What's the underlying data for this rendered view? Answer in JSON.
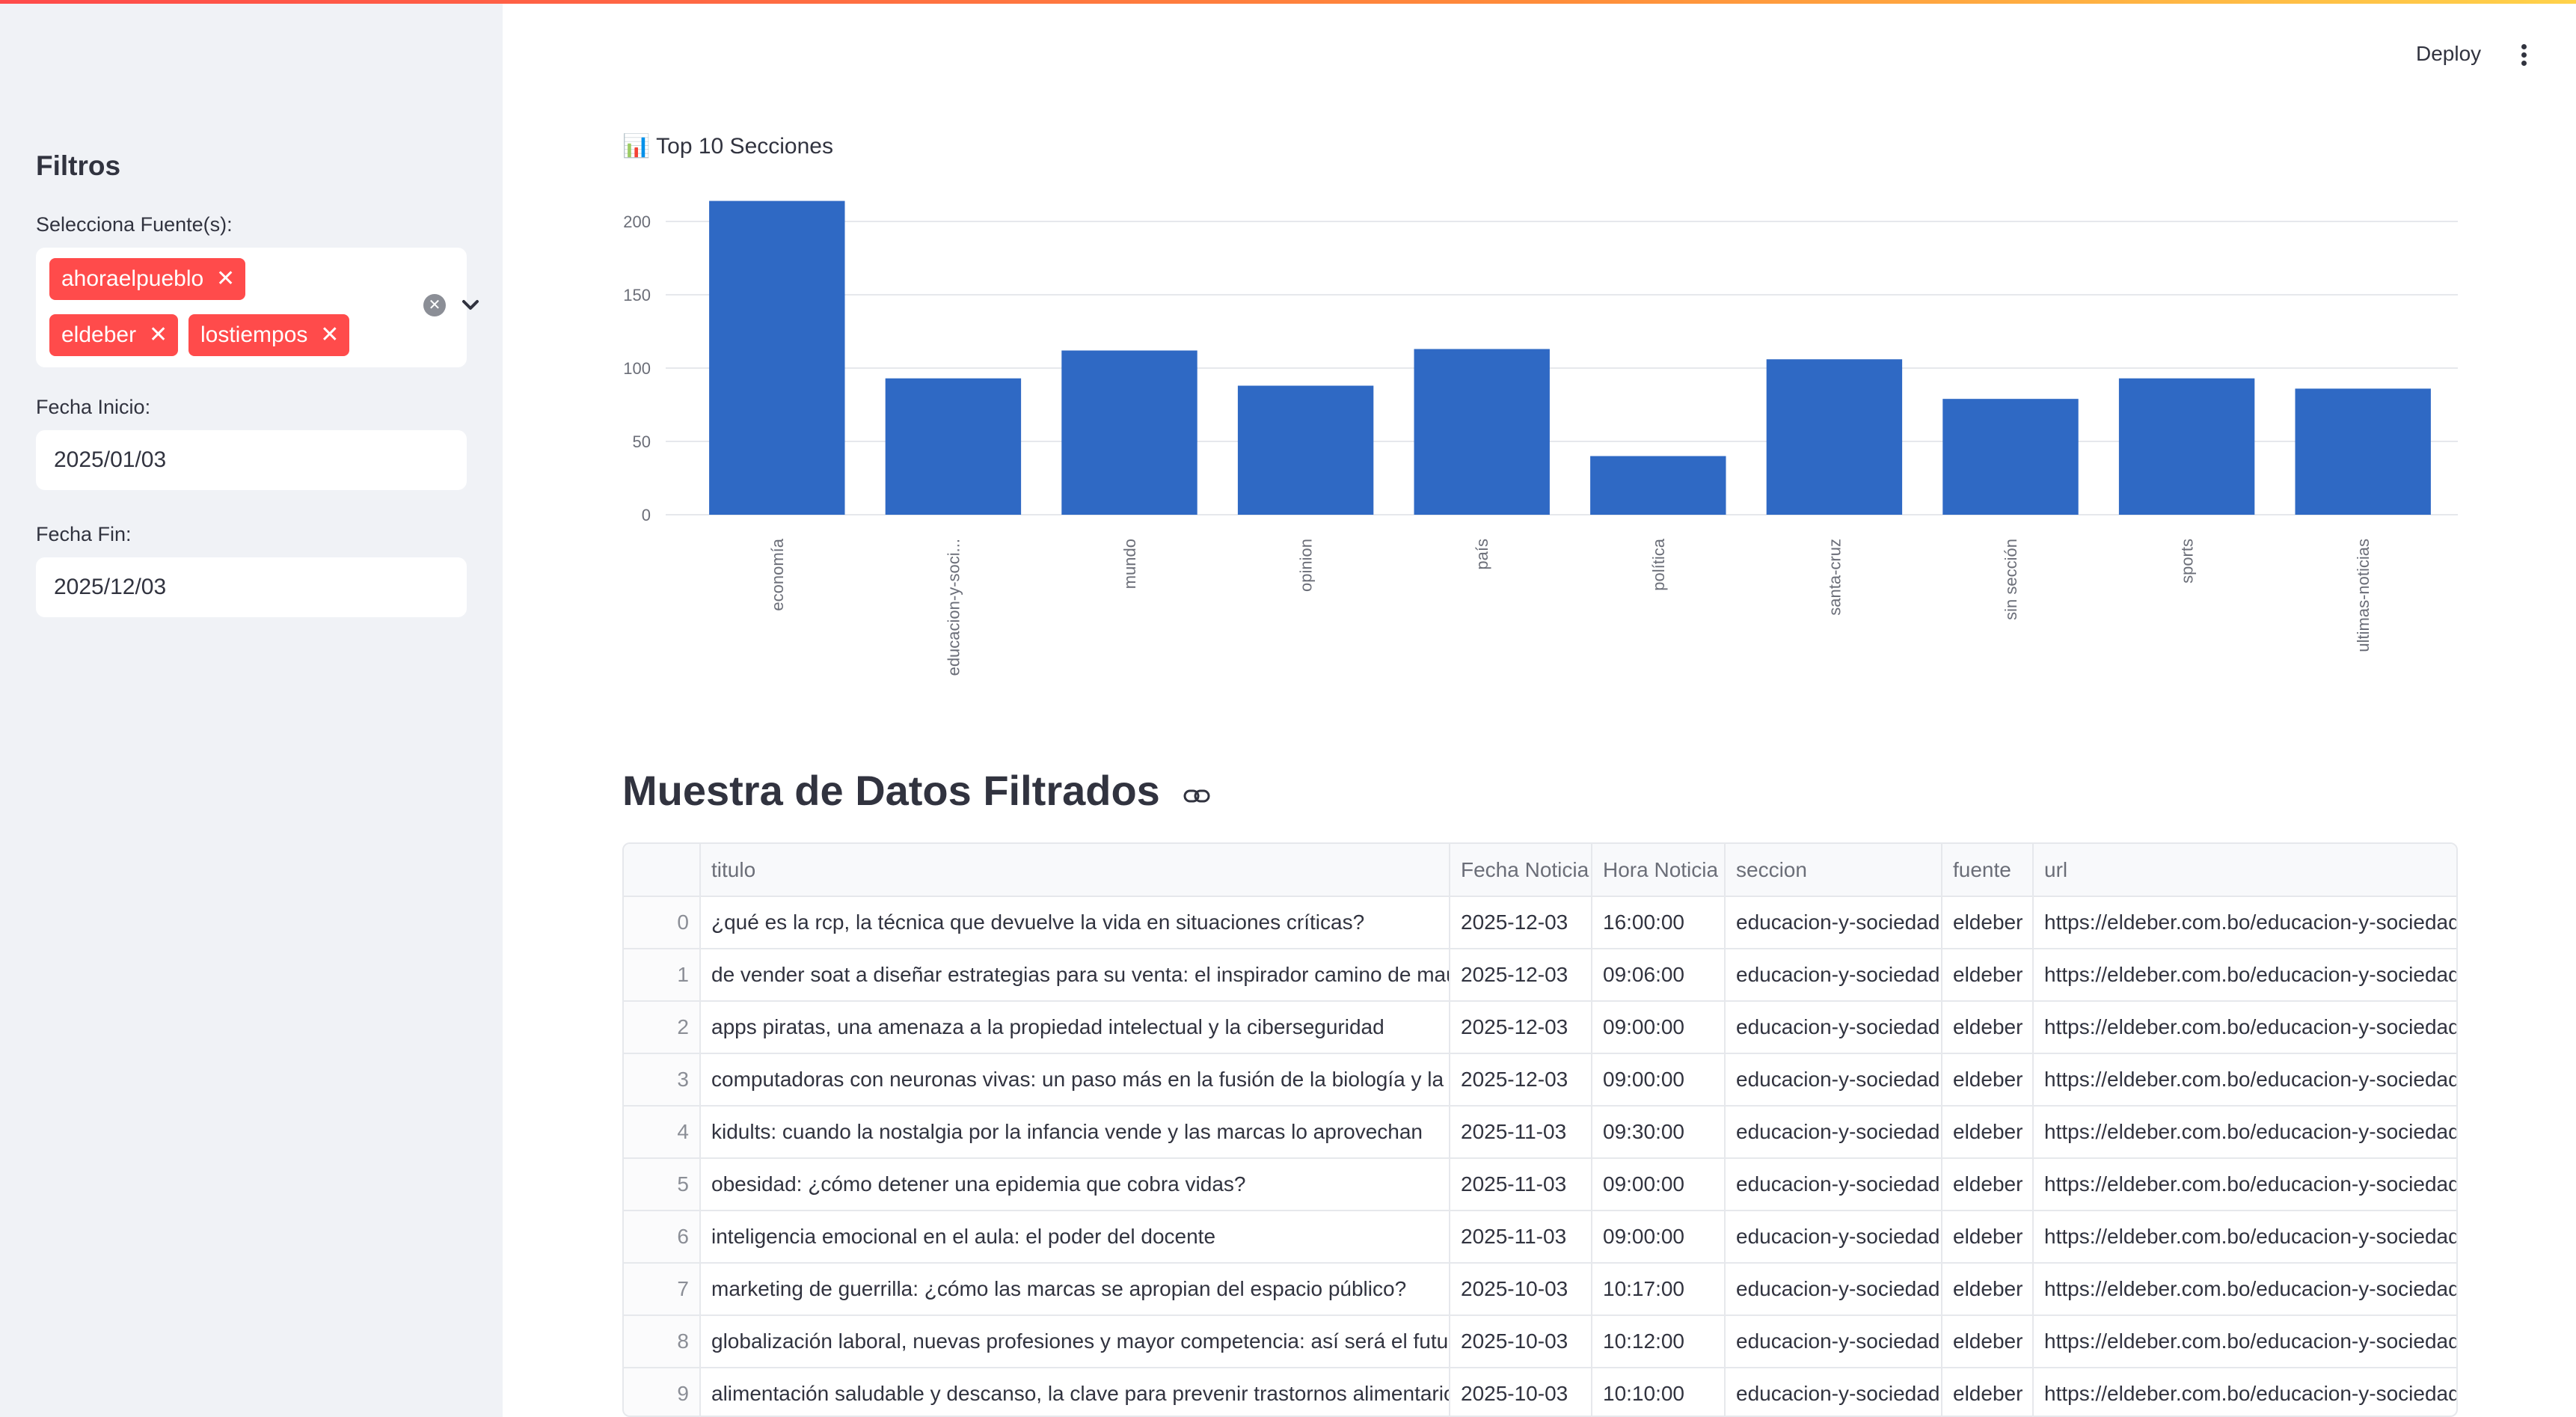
{
  "header": {
    "deploy_label": "Deploy",
    "menu_icon": "kebab-menu-icon"
  },
  "sidebar": {
    "title": "Filtros",
    "source_label": "Selecciona Fuente(s):",
    "selected_sources": [
      "ahoraelpueblo",
      "eldeber",
      "lostiempos"
    ],
    "start_label": "Fecha Inicio:",
    "start_value": "2025/01/03",
    "end_label": "Fecha Fin:",
    "end_value": "2025/12/03"
  },
  "chart_data": {
    "type": "bar",
    "title": "📊 Top 10 Secciones",
    "categories": [
      "economía",
      "educacion-y-soci...",
      "mundo",
      "opinion",
      "país",
      "política",
      "santa-cruz",
      "sin sección",
      "sports",
      "ultimas-noticias"
    ],
    "values": [
      214,
      93,
      112,
      88,
      113,
      40,
      106,
      79,
      93,
      86
    ],
    "ylim": [
      0,
      225
    ],
    "yticks": [
      0,
      50,
      100,
      150,
      200
    ],
    "grid": true,
    "bar_color": "#2f69c4"
  },
  "table": {
    "section_title": "Muestra de Datos Filtrados",
    "columns": [
      "",
      "titulo",
      "Fecha Noticia",
      "Hora Noticia",
      "seccion",
      "fuente",
      "url"
    ],
    "rows": [
      [
        "0",
        "¿qué es la rcp, la técnica que devuelve la vida en situaciones críticas?",
        "2025-12-03",
        "16:00:00",
        "educacion-y-sociedad",
        "eldeber",
        "https://eldeber.com.bo/educacion-y-sociedad/c"
      ],
      [
        "1",
        "de vender soat a diseñar estrategias para su venta: el inspirador camino de mauricio :",
        "2025-12-03",
        "09:06:00",
        "educacion-y-sociedad",
        "eldeber",
        "https://eldeber.com.bo/educacion-y-sociedad/c"
      ],
      [
        "2",
        "apps piratas, una amenaza a la propiedad intelectual y la ciberseguridad",
        "2025-12-03",
        "09:00:00",
        "educacion-y-sociedad",
        "eldeber",
        "https://eldeber.com.bo/educacion-y-sociedad/a"
      ],
      [
        "3",
        "computadoras con neuronas vivas: un paso más en la fusión de la biología y la tecnol",
        "2025-12-03",
        "09:00:00",
        "educacion-y-sociedad",
        "eldeber",
        "https://eldeber.com.bo/educacion-y-sociedad/c"
      ],
      [
        "4",
        "kidults: cuando la nostalgia por la infancia vende y las marcas lo aprovechan",
        "2025-11-03",
        "09:30:00",
        "educacion-y-sociedad",
        "eldeber",
        "https://eldeber.com.bo/educacion-y-sociedad/k"
      ],
      [
        "5",
        "obesidad: ¿cómo detener una epidemia que cobra vidas?",
        "2025-11-03",
        "09:00:00",
        "educacion-y-sociedad",
        "eldeber",
        "https://eldeber.com.bo/educacion-y-sociedad/c"
      ],
      [
        "6",
        "inteligencia emocional en el aula: el poder del docente",
        "2025-11-03",
        "09:00:00",
        "educacion-y-sociedad",
        "eldeber",
        "https://eldeber.com.bo/educacion-y-sociedad/i"
      ],
      [
        "7",
        "marketing de guerrilla: ¿cómo las marcas se apropian del espacio público?",
        "2025-10-03",
        "10:17:00",
        "educacion-y-sociedad",
        "eldeber",
        "https://eldeber.com.bo/educacion-y-sociedad/r"
      ],
      [
        "8",
        "globalización laboral, nuevas profesiones y mayor competencia: así será el futuro del",
        "2025-10-03",
        "10:12:00",
        "educacion-y-sociedad",
        "eldeber",
        "https://eldeber.com.bo/educacion-y-sociedad/g"
      ],
      [
        "9",
        "alimentación saludable y descanso, la clave para prevenir trastornos alimentarios",
        "2025-10-03",
        "10:10:00",
        "educacion-y-sociedad",
        "eldeber",
        "https://eldeber.com.bo/educacion-y-sociedad/a"
      ]
    ]
  }
}
